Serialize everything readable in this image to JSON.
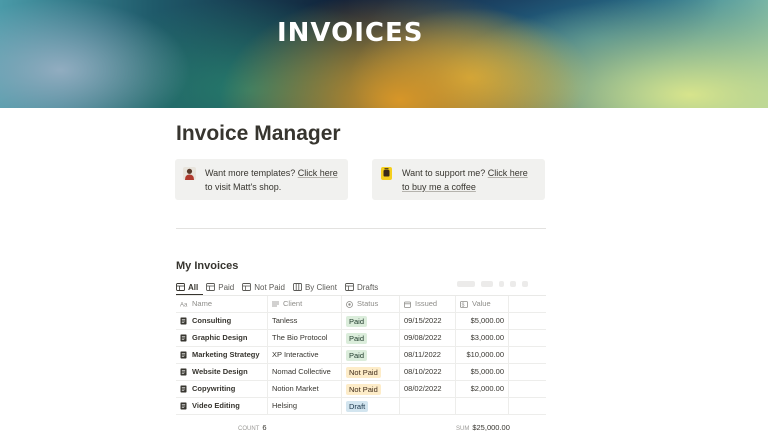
{
  "cover": {
    "title": "INVOICES"
  },
  "page": {
    "title": "Invoice Manager"
  },
  "callouts": [
    {
      "icon": "person-icon",
      "text_before": "Want more templates? ",
      "link": "Click here",
      "text_after": " to visit Matt's shop."
    },
    {
      "icon": "coffee-icon",
      "text_before": "Want to support me? ",
      "link": "Click here to buy me a coffee",
      "text_after": ""
    }
  ],
  "database": {
    "title": "My Invoices",
    "views": [
      "All",
      "Paid",
      "Not Paid",
      "By Client",
      "Drafts"
    ],
    "columns": {
      "name": "Name",
      "client": "Client",
      "status": "Status",
      "issued": "Issued",
      "value": "Value"
    },
    "rows": [
      {
        "name": "Consulting",
        "client": "Tanless",
        "status": "Paid",
        "issued": "09/15/2022",
        "value": "$5,000.00"
      },
      {
        "name": "Graphic Design",
        "client": "The Bio Protocol",
        "status": "Paid",
        "issued": "09/08/2022",
        "value": "$3,000.00"
      },
      {
        "name": "Marketing Strategy",
        "client": "XP Interactive",
        "status": "Paid",
        "issued": "08/11/2022",
        "value": "$10,000.00"
      },
      {
        "name": "Website Design",
        "client": "Nomad Collective",
        "status": "Not Paid",
        "issued": "08/10/2022",
        "value": "$5,000.00"
      },
      {
        "name": "Copywriting",
        "client": "Notion Market",
        "status": "Not Paid",
        "issued": "08/02/2022",
        "value": "$2,000.00"
      },
      {
        "name": "Video Editing",
        "client": "Helsing",
        "status": "Draft",
        "issued": "",
        "value": ""
      }
    ],
    "footer": {
      "count_label": "COUNT",
      "count_value": "6",
      "sum_label": "SUM",
      "sum_value": "$25,000.00"
    }
  },
  "colors": {
    "paid_bg": "#dbeddb",
    "not_paid_bg": "#fdecc8",
    "draft_bg": "#d3e5ef",
    "callout_bg": "#f1f1ef"
  }
}
